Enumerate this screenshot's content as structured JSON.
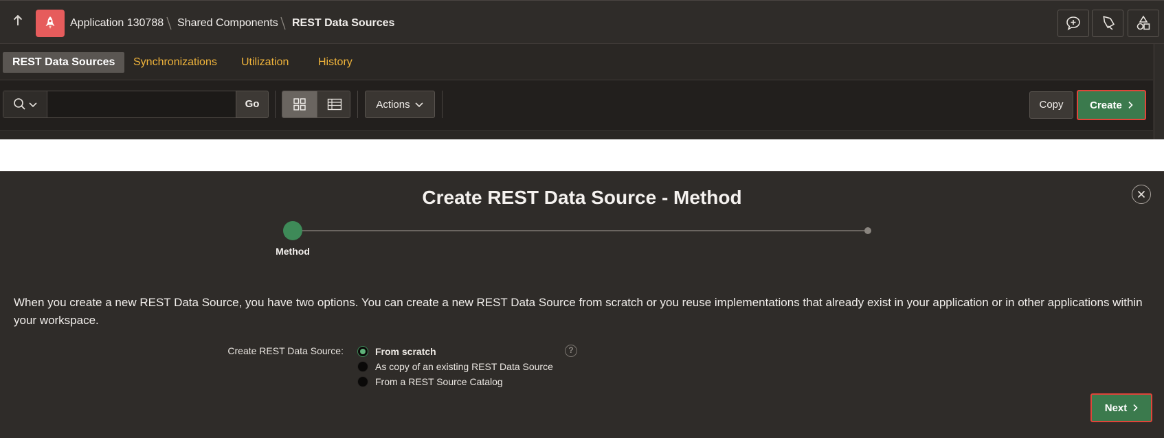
{
  "breadcrumb": {
    "items": [
      "Application 130788",
      "Shared Components",
      "REST Data Sources"
    ]
  },
  "header_buttons": [
    "add-comment-icon",
    "edit-icon",
    "shared-components-icon"
  ],
  "tabs": [
    {
      "label": "REST Data Sources",
      "active": true
    },
    {
      "label": "Synchronizations",
      "active": false
    },
    {
      "label": "Utilization",
      "active": false
    },
    {
      "label": "History",
      "active": false
    }
  ],
  "toolbar": {
    "search_value": "",
    "go_label": "Go",
    "actions_label": "Actions",
    "copy_label": "Copy",
    "create_label": "Create"
  },
  "dialog": {
    "title": "Create REST Data Source - Method",
    "step_label": "Method",
    "description": "When you create a new REST Data Source, you have two options. You can create a new REST Data Source from scratch or you reuse implementations that already exist in your application or in other applications within your workspace.",
    "field_label": "Create REST Data Source:",
    "options": [
      {
        "label": "From scratch",
        "selected": true
      },
      {
        "label": "As copy of an existing REST Data Source",
        "selected": false
      },
      {
        "label": "From a REST Source Catalog",
        "selected": false
      }
    ],
    "help_symbol": "?",
    "next_label": "Next"
  },
  "colors": {
    "accent_green": "#3b7a4d",
    "highlight_red": "#e0453a",
    "tab_orange": "#f0b43b",
    "app_icon_red": "#e65c5c"
  }
}
